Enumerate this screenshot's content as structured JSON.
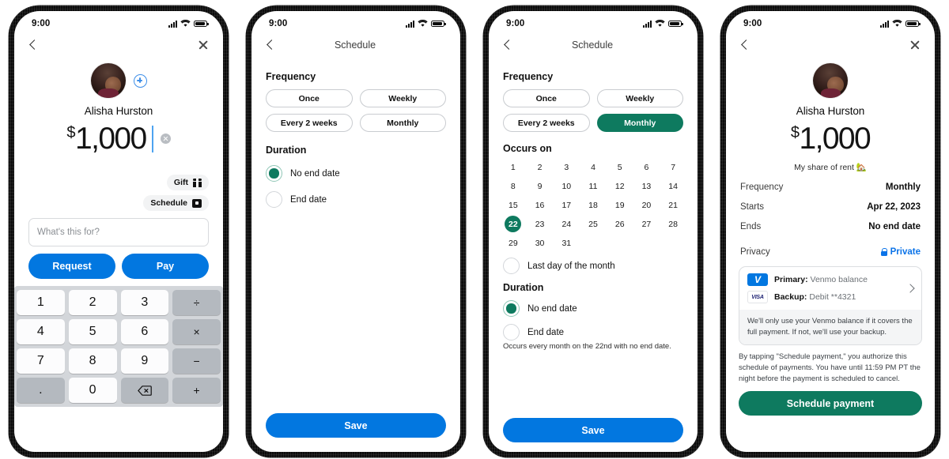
{
  "colors": {
    "blue": "#0277e0",
    "green": "#0e7a5f",
    "link_blue": "#0b73e8",
    "caret": "#4da3f0"
  },
  "status_bar": {
    "time": "9:00",
    "signal_icon": "cellular-bars-icon",
    "wifi_icon": "wifi-icon",
    "battery_icon": "battery-icon"
  },
  "screens": [
    {
      "id": "amount-entry",
      "nav": {
        "back_icon": "chevron-left-icon",
        "title": "",
        "close_icon": "close-icon"
      },
      "profile": {
        "avatar_name": "avatar",
        "add_icon": "add-person-icon",
        "name": "Alisha Hurston",
        "currency": "$",
        "amount": "1,000",
        "clear_icon": "clear-amount-icon"
      },
      "chips": [
        {
          "label": "Gift",
          "icon": "gift-icon"
        },
        {
          "label": "Schedule",
          "icon": "calendar-icon"
        }
      ],
      "note": {
        "placeholder": "What's this for?",
        "value": ""
      },
      "actions": {
        "request": "Request",
        "pay": "Pay"
      },
      "keypad": {
        "keys": [
          "1",
          "2",
          "3",
          "÷",
          "4",
          "5",
          "6",
          "×",
          "7",
          "8",
          "9",
          "−",
          ".",
          "0",
          "delete",
          "+"
        ],
        "delete_icon": "backspace-icon"
      }
    },
    {
      "id": "schedule-frequency",
      "nav": {
        "back_icon": "chevron-left-icon",
        "title": "Schedule"
      },
      "frequency": {
        "heading": "Frequency",
        "options": [
          "Once",
          "Weekly",
          "Every 2 weeks",
          "Monthly"
        ],
        "selected": null
      },
      "duration": {
        "heading": "Duration",
        "options": [
          "No end date",
          "End date"
        ],
        "selected": "No end date"
      },
      "save_label": "Save"
    },
    {
      "id": "schedule-monthly",
      "nav": {
        "back_icon": "chevron-left-icon",
        "title": "Schedule"
      },
      "frequency": {
        "heading": "Frequency",
        "options": [
          "Once",
          "Weekly",
          "Every 2 weeks",
          "Monthly"
        ],
        "selected": "Monthly"
      },
      "occurs_on": {
        "heading": "Occurs on",
        "days": [
          1,
          2,
          3,
          4,
          5,
          6,
          7,
          8,
          9,
          10,
          11,
          12,
          13,
          14,
          15,
          16,
          17,
          18,
          19,
          20,
          21,
          22,
          23,
          24,
          25,
          26,
          27,
          28,
          29,
          30,
          31
        ],
        "selected_day": 22,
        "last_day_label": "Last day of the month",
        "last_day_selected": false
      },
      "duration": {
        "heading": "Duration",
        "options": [
          "No end date",
          "End date"
        ],
        "selected": "No end date"
      },
      "summary": "Occurs every month on the 22nd with no end date.",
      "save_label": "Save"
    },
    {
      "id": "confirm-schedule",
      "nav": {
        "back_icon": "chevron-left-icon",
        "title": "",
        "close_icon": "close-icon"
      },
      "profile": {
        "avatar_name": "avatar",
        "name": "Alisha Hurston",
        "currency": "$",
        "amount": "1,000",
        "note": "My share of rent 🏡"
      },
      "details": [
        {
          "key": "Frequency",
          "value": "Monthly"
        },
        {
          "key": "Starts",
          "value": "Apr 22, 2023"
        },
        {
          "key": "Ends",
          "value": "No end date"
        }
      ],
      "privacy": {
        "key": "Privacy",
        "value": "Private",
        "icon": "lock-icon"
      },
      "payment_method": {
        "primary_label": "Primary:",
        "primary_value": "Venmo balance",
        "primary_icon": "venmo-logo-icon",
        "backup_label": "Backup:",
        "backup_value": "Debit **4321",
        "backup_icon": "visa-logo-icon",
        "chevron_icon": "chevron-right-icon",
        "footnote": "We'll only use your Venmo balance if it covers the full payment. If not, we'll use your backup."
      },
      "legal": "By tapping \"Schedule payment,\" you authorize this schedule of payments. You have until 11:59 PM PT the night before the payment is scheduled to cancel.",
      "cta_label": "Schedule payment"
    }
  ]
}
